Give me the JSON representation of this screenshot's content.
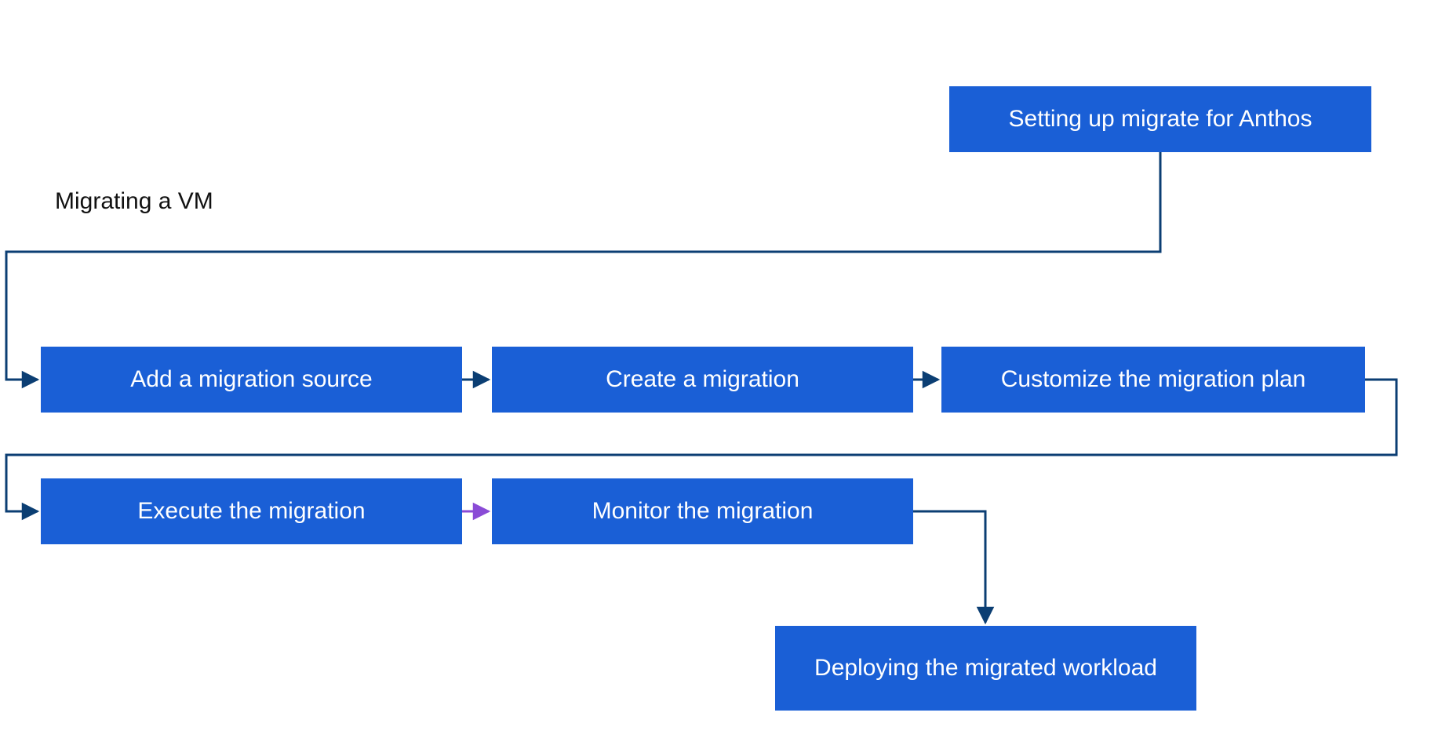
{
  "title": "Migrating a VM",
  "colors": {
    "node_fill": "#1a5fd6",
    "node_text": "#ffffff",
    "line_primary": "#0b3e73",
    "line_accent": "#8a4bd6",
    "title_text": "#111111"
  },
  "nodes": {
    "setup": {
      "label": "Setting up migrate for Anthos"
    },
    "add_source": {
      "label": "Add a migration source"
    },
    "create": {
      "label": "Create a migration"
    },
    "customize": {
      "label": "Customize the migration plan"
    },
    "execute": {
      "label": "Execute the migration"
    },
    "monitor": {
      "label": "Monitor the migration"
    },
    "deploy": {
      "label": "Deploying the migrated workload"
    }
  },
  "flow": [
    "setup",
    "add_source",
    "create",
    "customize",
    "execute",
    "monitor",
    "deploy"
  ]
}
